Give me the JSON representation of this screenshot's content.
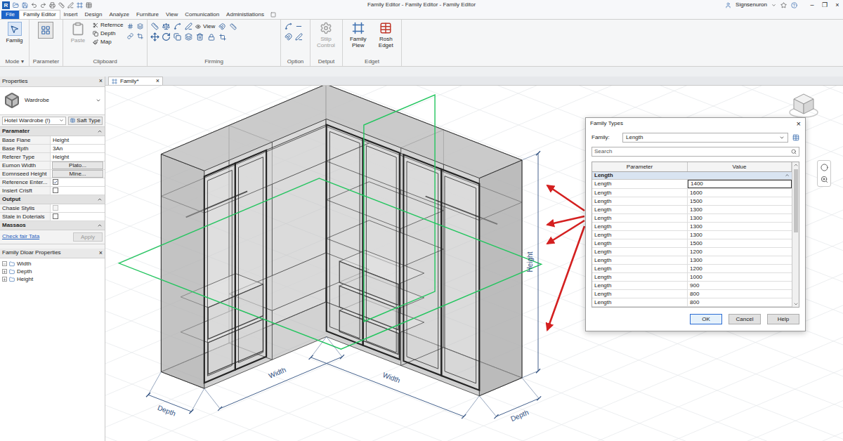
{
  "window": {
    "app_logo": "R",
    "title": "Family Editor - Family Editor - Family Editor",
    "user": "Signsenuron",
    "controls": [
      "–",
      "❐",
      "×"
    ]
  },
  "ribbon_tabs": [
    {
      "label": "File",
      "selected": false,
      "kind": "app"
    },
    {
      "label": "Family Editor",
      "selected": true,
      "kind": "tab"
    },
    {
      "label": "Insert",
      "selected": false,
      "kind": "tab"
    },
    {
      "label": "Design",
      "selected": false,
      "kind": "tab"
    },
    {
      "label": "Analyze",
      "selected": false,
      "kind": "tab"
    },
    {
      "label": "Furniture",
      "selected": false,
      "kind": "tab"
    },
    {
      "label": "View",
      "selected": false,
      "kind": "tab"
    },
    {
      "label": "Comunication",
      "selected": false,
      "kind": "tab"
    },
    {
      "label": "Administiations",
      "selected": false,
      "kind": "tab"
    }
  ],
  "ribbon_groups": [
    {
      "label": "Mode ▾",
      "tools": [
        {
          "label": "Familg",
          "kind": "large",
          "disabled": false
        }
      ]
    },
    {
      "label": "Parameter",
      "tools": []
    },
    {
      "label": "Clipboard",
      "tools": [
        {
          "label": "Paste",
          "kind": "large",
          "disabled": true
        },
        {
          "label": "Refernce",
          "kind": "small",
          "disabled": false
        },
        {
          "label": "Depth",
          "kind": "small",
          "disabled": false
        },
        {
          "label": "Map",
          "kind": "small",
          "disabled": false
        }
      ]
    },
    {
      "label": "Firming",
      "tools": [
        {
          "label": "View",
          "kind": "small",
          "disabled": false
        }
      ]
    },
    {
      "label": "Option",
      "tools": []
    },
    {
      "label": "Detput",
      "tools": [
        {
          "label": "Stiip Control",
          "kind": "large",
          "disabled": true
        }
      ]
    },
    {
      "label": "Edget",
      "tools": [
        {
          "label": "Family Plew",
          "kind": "large",
          "disabled": false
        },
        {
          "label": "Rosh Edget",
          "kind": "large",
          "disabled": false
        }
      ]
    }
  ],
  "properties": {
    "title": "Properties",
    "close": "×",
    "type_name": "Wardrobe",
    "type_selector": "Hotel Wardrobe (!)",
    "edit_type": "Saft Type",
    "sections": [
      {
        "title": "Paramater",
        "expanded": true,
        "rows": [
          {
            "name": "Base Fiane",
            "kind": "text",
            "value": "Height"
          },
          {
            "name": "Base Rpth",
            "kind": "text",
            "value": "3An"
          },
          {
            "name": "Referer Type",
            "kind": "text",
            "value": "Height"
          },
          {
            "name": "Eumon Width",
            "kind": "button",
            "value": "Plato..."
          },
          {
            "name": "Eomnseed Height",
            "kind": "button",
            "value": "Mine..."
          },
          {
            "name": "Reference Enter...",
            "kind": "checkbox",
            "checked": true,
            "disabled": false
          },
          {
            "name": "Insiert Crisft",
            "kind": "checkbox",
            "checked": false,
            "disabled": false
          }
        ]
      },
      {
        "title": "Output",
        "expanded": true,
        "rows": [
          {
            "name": "Chasie Stylis",
            "kind": "checkbox",
            "checked": false,
            "disabled": true
          },
          {
            "name": "Stale in Doterials",
            "kind": "checkbox",
            "checked": false,
            "disabled": false
          }
        ]
      },
      {
        "title": "Massaos",
        "expanded": true,
        "rows": []
      }
    ],
    "link": "Check fair Tata",
    "apply": {
      "label": "Apply",
      "disabled": true
    }
  },
  "family_properties": {
    "title": "Family Dloar Properties",
    "close": "×",
    "items": [
      {
        "label": "Width",
        "expanded": true
      },
      {
        "label": "Depth",
        "expanded": false
      },
      {
        "label": "Height",
        "expanded": false
      }
    ]
  },
  "view_tab": {
    "label": "Family*",
    "close": "×"
  },
  "dimensions": [
    "Depth",
    "Width",
    "Width",
    "Depth",
    "Height"
  ],
  "dialog": {
    "title": "Family Types",
    "close": "×",
    "family_label": "Family:",
    "family_value": "Length",
    "search_placeholder": "Search",
    "columns": [
      "Parameter",
      "Value"
    ],
    "group": {
      "label": "Length",
      "expanded": true
    },
    "rows": [
      {
        "parameter": "Length",
        "value": "1400",
        "selected": true
      },
      {
        "parameter": "Length",
        "value": "1600",
        "selected": false
      },
      {
        "parameter": "Length",
        "value": "1500",
        "selected": false
      },
      {
        "parameter": "Length",
        "value": "1300",
        "selected": false
      },
      {
        "parameter": "Length",
        "value": "1300",
        "selected": false
      },
      {
        "parameter": "Length",
        "value": "1300",
        "selected": false
      },
      {
        "parameter": "Length",
        "value": "1300",
        "selected": false
      },
      {
        "parameter": "Length",
        "value": "1500",
        "selected": false
      },
      {
        "parameter": "Length",
        "value": "1200",
        "selected": false
      },
      {
        "parameter": "Length",
        "value": "1300",
        "selected": false
      },
      {
        "parameter": "Length",
        "value": "1200",
        "selected": false
      },
      {
        "parameter": "Length",
        "value": "1000",
        "selected": false
      },
      {
        "parameter": "Length",
        "value": "900",
        "selected": false
      },
      {
        "parameter": "Length",
        "value": "800",
        "selected": false
      },
      {
        "parameter": "Length",
        "value": "800",
        "selected": false
      }
    ],
    "buttons": [
      {
        "label": "OK",
        "default": true
      },
      {
        "label": "Cancel",
        "default": false
      },
      {
        "label": "Help",
        "default": false
      }
    ]
  }
}
